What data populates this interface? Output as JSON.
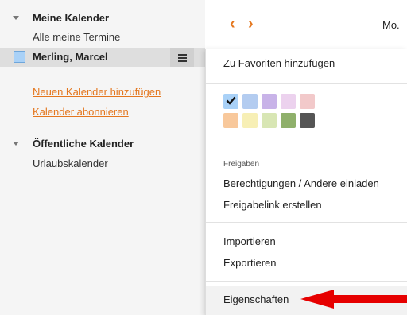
{
  "sidebar": {
    "my_calendars_header": "Meine Kalender",
    "all_appointments": "Alle meine Termine",
    "selected_calendar": "Merling, Marcel",
    "add_calendar_link": "Neuen Kalender hinzufügen",
    "subscribe_link": "Kalender abonnieren",
    "public_calendars_header": "Öffentliche Kalender",
    "vacation_calendar": "Urlaubskalender"
  },
  "toolbar": {
    "prev_icon": "chevron-left-icon",
    "next_icon": "chevron-right-icon",
    "day_label": "Mo."
  },
  "context_menu": {
    "add_favorite": "Zu Favoriten hinzufügen",
    "colors": [
      "#a9d1f7",
      "#b3ccf0",
      "#c8b3e8",
      "#ecd2ee",
      "#f2c9ca",
      "#f8c89b",
      "#f7efb5",
      "#d8e6b4",
      "#8fb06b",
      "#555555"
    ],
    "selected_color": "#a9d1f7",
    "sharing_section": "Freigaben",
    "permissions": "Berechtigungen / Andere einladen",
    "create_share_link": "Freigabelink erstellen",
    "import": "Importieren",
    "export": "Exportieren",
    "properties": "Eigenschaften"
  },
  "accent_color": "#e4771f",
  "annotation_arrow_color": "#e60000"
}
